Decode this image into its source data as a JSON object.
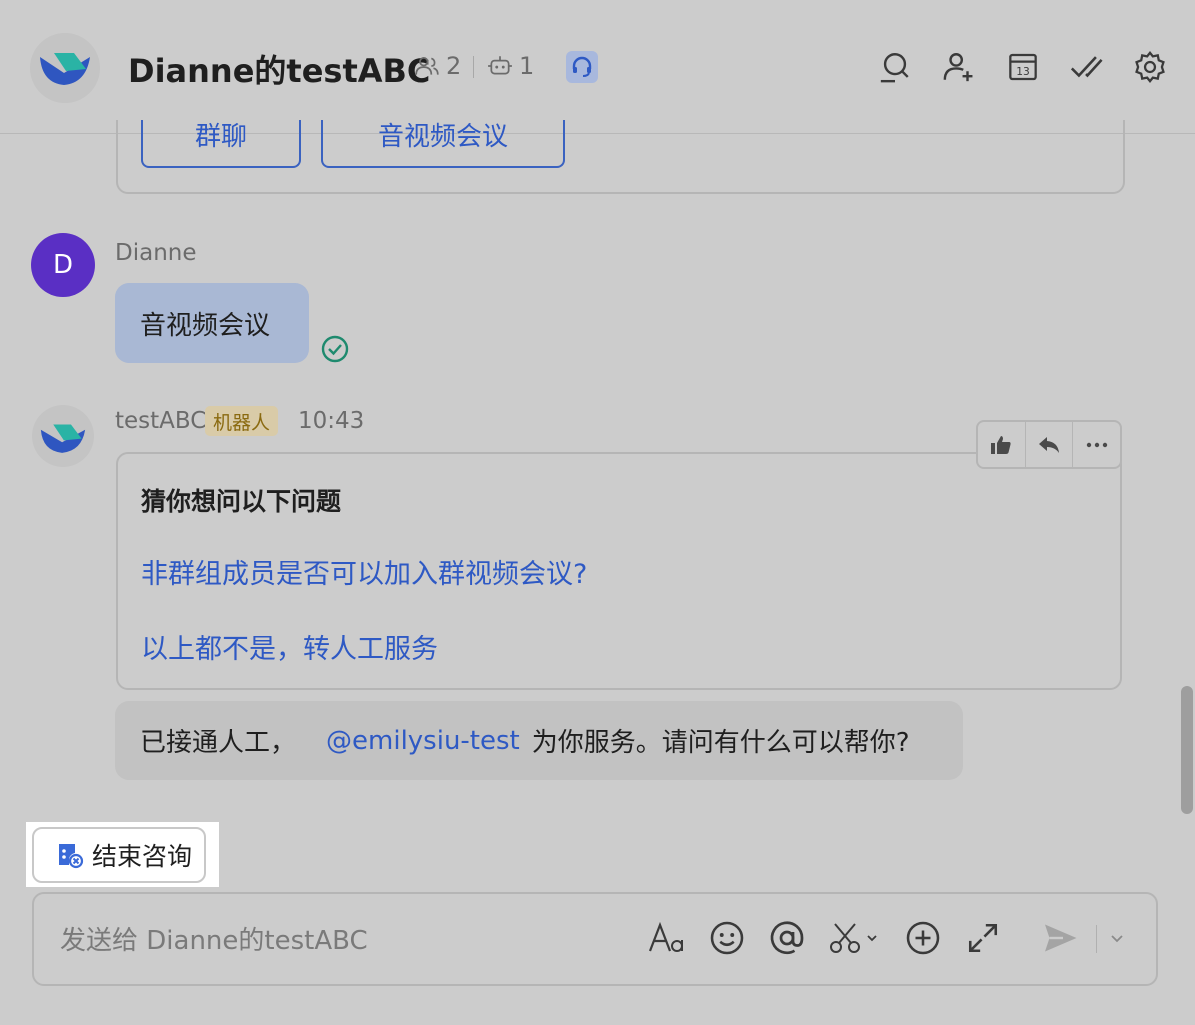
{
  "header": {
    "title": "Dianne的testABC",
    "member_count": "2",
    "bot_count": "1"
  },
  "top_card": {
    "buttons": [
      "群聊",
      "音视频会议"
    ]
  },
  "messages": {
    "user": {
      "avatar_letter": "D",
      "sender": "Dianne",
      "text": "音视频会议"
    },
    "bot": {
      "sender": "testABC",
      "tag": "机器人",
      "time": "10:43",
      "faq_title": "猜你想问以下问题",
      "faq_links": [
        "非群组成员是否可以加入群视频会议?",
        "以上都不是，转人工服务"
      ]
    },
    "system": {
      "prefix": "已接通人工，",
      "mention": "@emilysiu-test",
      "suffix": "为你服务。请问有什么可以帮你?"
    }
  },
  "end_consult": {
    "label": "结束咨询"
  },
  "composer": {
    "placeholder": "发送给 Dianne的testABC"
  },
  "colors": {
    "link": "#2e59c4",
    "brand": "#3a62c0",
    "avatar": "#5a2fc4"
  }
}
